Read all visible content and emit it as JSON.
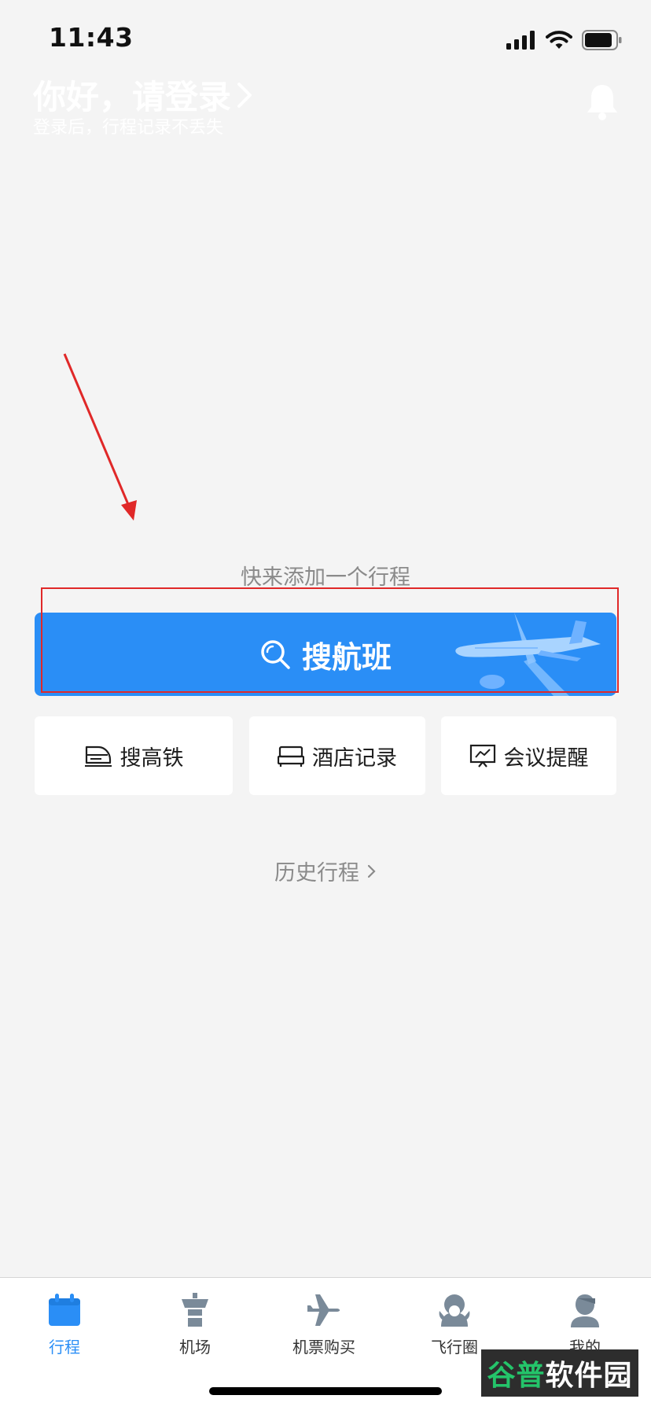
{
  "status_bar": {
    "time": "11:43"
  },
  "header": {
    "login_title": "你好，请登录",
    "login_subtitle": "登录后，行程记录不丢失"
  },
  "main": {
    "empty_hint": "快来添加一个行程",
    "search_flight_label": "搜航班",
    "options": [
      {
        "label": "搜高铁",
        "icon": "train-icon"
      },
      {
        "label": "酒店记录",
        "icon": "bed-icon"
      },
      {
        "label": "会议提醒",
        "icon": "presentation-icon"
      }
    ],
    "history_label": "历史行程"
  },
  "tab_bar": {
    "items": [
      {
        "label": "行程",
        "icon": "calendar-icon",
        "active": true
      },
      {
        "label": "机场",
        "icon": "control-tower-icon",
        "active": false
      },
      {
        "label": "机票购买",
        "icon": "airplane-icon",
        "active": false
      },
      {
        "label": "飞行圈",
        "icon": "community-icon",
        "active": false
      },
      {
        "label": "我的",
        "icon": "user-icon",
        "active": false
      }
    ]
  },
  "watermark": {
    "part1": "谷普",
    "part2": "软件园"
  },
  "colors": {
    "accent": "#2a8ef6",
    "background": "#f4f4f4",
    "annotation": "#e02828"
  }
}
